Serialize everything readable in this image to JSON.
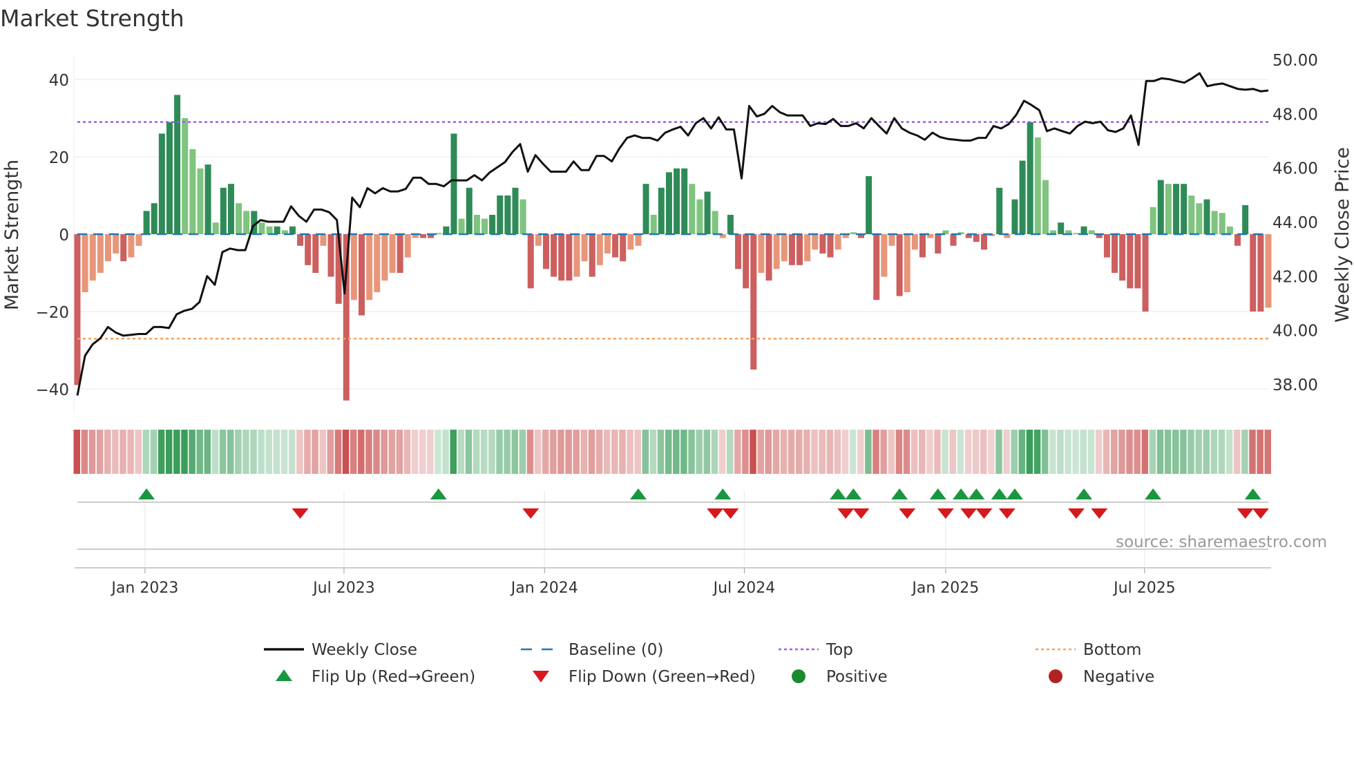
{
  "chart_data": {
    "type": "bar",
    "title": "Market Strength",
    "ylabel": "Market Strength",
    "y2label": "Weekly Close Price",
    "ylim": [
      -44,
      46
    ],
    "y2lim": [
      37.2,
      50.6
    ],
    "yticks": [
      40,
      20,
      0,
      -20,
      -40
    ],
    "ytick_labels": [
      "40",
      "20",
      "0",
      "−20",
      "−40"
    ],
    "y2ticks": [
      50,
      48,
      46,
      44,
      42,
      40,
      38
    ],
    "y2tick_labels": [
      "50.00",
      "48.00",
      "46.00",
      "44.00",
      "42.00",
      "40.00",
      "38.00"
    ],
    "xticks": [
      {
        "label": "Jan 2023",
        "week": 8.8
      },
      {
        "label": "Jul 2023",
        "week": 34.7
      },
      {
        "label": "Jan 2024",
        "week": 60.8
      },
      {
        "label": "Jul 2024",
        "week": 86.8
      },
      {
        "label": "Jan 2025",
        "week": 113
      },
      {
        "label": "Jul 2025",
        "week": 138.9
      }
    ],
    "top_level": 29,
    "bottom_level": -27,
    "baseline": 0,
    "strength": [
      -39,
      -15,
      -12,
      -10,
      -7,
      -5,
      -7,
      -6,
      -3,
      6,
      8,
      26,
      29,
      36,
      30,
      22,
      17,
      18,
      3,
      12,
      13,
      8,
      6,
      6,
      3,
      2,
      2,
      1,
      2,
      -3,
      -8,
      -10,
      -3,
      -11,
      -18,
      -43,
      -17,
      -21,
      -17,
      -15,
      -12,
      -10,
      -10,
      -6,
      -1,
      -1,
      -1,
      0.3,
      2,
      26,
      4,
      12,
      5,
      4,
      5,
      10,
      10,
      12,
      9,
      -14,
      -3,
      -9,
      -11,
      -12,
      -12,
      -11,
      -7,
      -11,
      -8,
      -5,
      -6,
      -7,
      -4,
      -3,
      13,
      5,
      12,
      16,
      17,
      17,
      13,
      9,
      11,
      6,
      -1,
      5,
      -9,
      -14,
      -35,
      -10,
      -12,
      -9,
      -7,
      -8,
      -8,
      -7,
      -4,
      -5,
      -6,
      -4,
      -1,
      0.5,
      -1,
      15,
      -17,
      -11,
      -3,
      -16,
      -15,
      -4,
      -6,
      -1,
      -5,
      1,
      -3,
      0.5,
      -1,
      -2,
      -4,
      -0.5,
      12,
      -1,
      9,
      19,
      29,
      25,
      14,
      1,
      3,
      1,
      0.3,
      2,
      1,
      -1,
      -6,
      -10,
      -12,
      -14,
      -14,
      -20,
      7,
      14,
      13,
      13,
      13,
      10,
      8,
      9,
      6,
      5.5,
      2,
      -3,
      7.5,
      -20,
      -20,
      -19
    ],
    "weekly_close": [
      37.58,
      39.05,
      39.47,
      39.69,
      40.11,
      39.91,
      39.79,
      39.82,
      39.85,
      39.85,
      40.11,
      40.11,
      40.07,
      40.58,
      40.71,
      40.78,
      41.03,
      41.99,
      41.67,
      42.88,
      43.01,
      42.95,
      42.95,
      43.84,
      44.06,
      44.0,
      44.0,
      44.0,
      44.57,
      44.22,
      44.0,
      44.45,
      44.45,
      44.35,
      44.06,
      41.35,
      44.89,
      44.54,
      45.24,
      45.05,
      45.24,
      45.12,
      45.12,
      45.21,
      45.63,
      45.63,
      45.4,
      45.4,
      45.31,
      45.53,
      45.53,
      45.53,
      45.72,
      45.53,
      45.82,
      46.01,
      46.2,
      46.58,
      46.87,
      45.85,
      46.46,
      46.14,
      45.85,
      45.85,
      45.85,
      46.23,
      45.91,
      45.91,
      46.43,
      46.43,
      46.23,
      46.71,
      47.1,
      47.19,
      47.1,
      47.1,
      47.0,
      47.29,
      47.41,
      47.51,
      47.19,
      47.64,
      47.83,
      47.45,
      47.86,
      47.41,
      47.41,
      45.6,
      48.28,
      47.89,
      47.99,
      48.28,
      48.05,
      47.93,
      47.93,
      47.93,
      47.54,
      47.64,
      47.61,
      47.8,
      47.54,
      47.54,
      47.64,
      47.45,
      47.83,
      47.54,
      47.26,
      47.83,
      47.45,
      47.29,
      47.19,
      47.03,
      47.29,
      47.13,
      47.06,
      47.03,
      47.0,
      47.0,
      47.1,
      47.1,
      47.54,
      47.45,
      47.61,
      47.96,
      48.47,
      48.31,
      48.12,
      47.35,
      47.45,
      47.35,
      47.26,
      47.54,
      47.7,
      47.64,
      47.7,
      47.38,
      47.32,
      47.45,
      47.93,
      46.84,
      49.2,
      49.2,
      49.3,
      49.27,
      49.2,
      49.14,
      49.3,
      49.49,
      49.01,
      49.07,
      49.11,
      49.01,
      48.91,
      48.88,
      48.91,
      48.82,
      48.85
    ],
    "flip_up_weeks": [
      9,
      47,
      73,
      84,
      99,
      101,
      107,
      112,
      115,
      117,
      120,
      122,
      131,
      140,
      153
    ],
    "flip_down_weeks": [
      29,
      59,
      83,
      85,
      100,
      102,
      108,
      113,
      116,
      118,
      121,
      130,
      133,
      152,
      154
    ],
    "legend": [
      {
        "label": "Weekly Close",
        "kind": "line",
        "color": "#111111"
      },
      {
        "label": "Baseline (0)",
        "kind": "dash",
        "color": "#1f77b4"
      },
      {
        "label": "Top",
        "kind": "dot",
        "color": "#9b5de5"
      },
      {
        "label": "Bottom",
        "kind": "dot",
        "color": "#f4a261"
      },
      {
        "label": "Flip Up (Red→Green)",
        "kind": "up",
        "color": "#1a9641"
      },
      {
        "label": "Flip Down (Green→Red)",
        "kind": "down",
        "color": "#d7191c"
      },
      {
        "label": "Positive",
        "kind": "circle",
        "color": "#1a8a2e"
      },
      {
        "label": "Negative",
        "kind": "circle",
        "color": "#b22222"
      }
    ],
    "legend_position": "bottom-center",
    "colors": {
      "pos_dark": "#2e8b57",
      "pos_light": "#7fc47f",
      "neg_dark": "#cd5f5f",
      "neg_light": "#e8967a"
    }
  },
  "source": "source: sharemaestro.com"
}
